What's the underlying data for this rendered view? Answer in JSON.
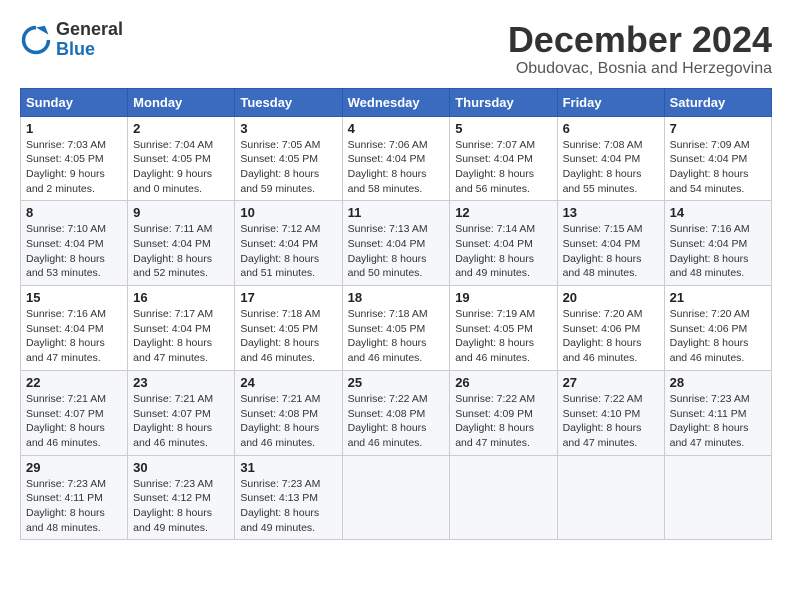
{
  "logo": {
    "general": "General",
    "blue": "Blue"
  },
  "title": "December 2024",
  "subtitle": "Obudovac, Bosnia and Herzegovina",
  "headers": [
    "Sunday",
    "Monday",
    "Tuesday",
    "Wednesday",
    "Thursday",
    "Friday",
    "Saturday"
  ],
  "weeks": [
    [
      {
        "day": "1",
        "sunrise": "Sunrise: 7:03 AM",
        "sunset": "Sunset: 4:05 PM",
        "daylight": "Daylight: 9 hours and 2 minutes."
      },
      {
        "day": "2",
        "sunrise": "Sunrise: 7:04 AM",
        "sunset": "Sunset: 4:05 PM",
        "daylight": "Daylight: 9 hours and 0 minutes."
      },
      {
        "day": "3",
        "sunrise": "Sunrise: 7:05 AM",
        "sunset": "Sunset: 4:05 PM",
        "daylight": "Daylight: 8 hours and 59 minutes."
      },
      {
        "day": "4",
        "sunrise": "Sunrise: 7:06 AM",
        "sunset": "Sunset: 4:04 PM",
        "daylight": "Daylight: 8 hours and 58 minutes."
      },
      {
        "day": "5",
        "sunrise": "Sunrise: 7:07 AM",
        "sunset": "Sunset: 4:04 PM",
        "daylight": "Daylight: 8 hours and 56 minutes."
      },
      {
        "day": "6",
        "sunrise": "Sunrise: 7:08 AM",
        "sunset": "Sunset: 4:04 PM",
        "daylight": "Daylight: 8 hours and 55 minutes."
      },
      {
        "day": "7",
        "sunrise": "Sunrise: 7:09 AM",
        "sunset": "Sunset: 4:04 PM",
        "daylight": "Daylight: 8 hours and 54 minutes."
      }
    ],
    [
      {
        "day": "8",
        "sunrise": "Sunrise: 7:10 AM",
        "sunset": "Sunset: 4:04 PM",
        "daylight": "Daylight: 8 hours and 53 minutes."
      },
      {
        "day": "9",
        "sunrise": "Sunrise: 7:11 AM",
        "sunset": "Sunset: 4:04 PM",
        "daylight": "Daylight: 8 hours and 52 minutes."
      },
      {
        "day": "10",
        "sunrise": "Sunrise: 7:12 AM",
        "sunset": "Sunset: 4:04 PM",
        "daylight": "Daylight: 8 hours and 51 minutes."
      },
      {
        "day": "11",
        "sunrise": "Sunrise: 7:13 AM",
        "sunset": "Sunset: 4:04 PM",
        "daylight": "Daylight: 8 hours and 50 minutes."
      },
      {
        "day": "12",
        "sunrise": "Sunrise: 7:14 AM",
        "sunset": "Sunset: 4:04 PM",
        "daylight": "Daylight: 8 hours and 49 minutes."
      },
      {
        "day": "13",
        "sunrise": "Sunrise: 7:15 AM",
        "sunset": "Sunset: 4:04 PM",
        "daylight": "Daylight: 8 hours and 48 minutes."
      },
      {
        "day": "14",
        "sunrise": "Sunrise: 7:16 AM",
        "sunset": "Sunset: 4:04 PM",
        "daylight": "Daylight: 8 hours and 48 minutes."
      }
    ],
    [
      {
        "day": "15",
        "sunrise": "Sunrise: 7:16 AM",
        "sunset": "Sunset: 4:04 PM",
        "daylight": "Daylight: 8 hours and 47 minutes."
      },
      {
        "day": "16",
        "sunrise": "Sunrise: 7:17 AM",
        "sunset": "Sunset: 4:04 PM",
        "daylight": "Daylight: 8 hours and 47 minutes."
      },
      {
        "day": "17",
        "sunrise": "Sunrise: 7:18 AM",
        "sunset": "Sunset: 4:05 PM",
        "daylight": "Daylight: 8 hours and 46 minutes."
      },
      {
        "day": "18",
        "sunrise": "Sunrise: 7:18 AM",
        "sunset": "Sunset: 4:05 PM",
        "daylight": "Daylight: 8 hours and 46 minutes."
      },
      {
        "day": "19",
        "sunrise": "Sunrise: 7:19 AM",
        "sunset": "Sunset: 4:05 PM",
        "daylight": "Daylight: 8 hours and 46 minutes."
      },
      {
        "day": "20",
        "sunrise": "Sunrise: 7:20 AM",
        "sunset": "Sunset: 4:06 PM",
        "daylight": "Daylight: 8 hours and 46 minutes."
      },
      {
        "day": "21",
        "sunrise": "Sunrise: 7:20 AM",
        "sunset": "Sunset: 4:06 PM",
        "daylight": "Daylight: 8 hours and 46 minutes."
      }
    ],
    [
      {
        "day": "22",
        "sunrise": "Sunrise: 7:21 AM",
        "sunset": "Sunset: 4:07 PM",
        "daylight": "Daylight: 8 hours and 46 minutes."
      },
      {
        "day": "23",
        "sunrise": "Sunrise: 7:21 AM",
        "sunset": "Sunset: 4:07 PM",
        "daylight": "Daylight: 8 hours and 46 minutes."
      },
      {
        "day": "24",
        "sunrise": "Sunrise: 7:21 AM",
        "sunset": "Sunset: 4:08 PM",
        "daylight": "Daylight: 8 hours and 46 minutes."
      },
      {
        "day": "25",
        "sunrise": "Sunrise: 7:22 AM",
        "sunset": "Sunset: 4:08 PM",
        "daylight": "Daylight: 8 hours and 46 minutes."
      },
      {
        "day": "26",
        "sunrise": "Sunrise: 7:22 AM",
        "sunset": "Sunset: 4:09 PM",
        "daylight": "Daylight: 8 hours and 47 minutes."
      },
      {
        "day": "27",
        "sunrise": "Sunrise: 7:22 AM",
        "sunset": "Sunset: 4:10 PM",
        "daylight": "Daylight: 8 hours and 47 minutes."
      },
      {
        "day": "28",
        "sunrise": "Sunrise: 7:23 AM",
        "sunset": "Sunset: 4:11 PM",
        "daylight": "Daylight: 8 hours and 47 minutes."
      }
    ],
    [
      {
        "day": "29",
        "sunrise": "Sunrise: 7:23 AM",
        "sunset": "Sunset: 4:11 PM",
        "daylight": "Daylight: 8 hours and 48 minutes."
      },
      {
        "day": "30",
        "sunrise": "Sunrise: 7:23 AM",
        "sunset": "Sunset: 4:12 PM",
        "daylight": "Daylight: 8 hours and 49 minutes."
      },
      {
        "day": "31",
        "sunrise": "Sunrise: 7:23 AM",
        "sunset": "Sunset: 4:13 PM",
        "daylight": "Daylight: 8 hours and 49 minutes."
      },
      null,
      null,
      null,
      null
    ]
  ]
}
